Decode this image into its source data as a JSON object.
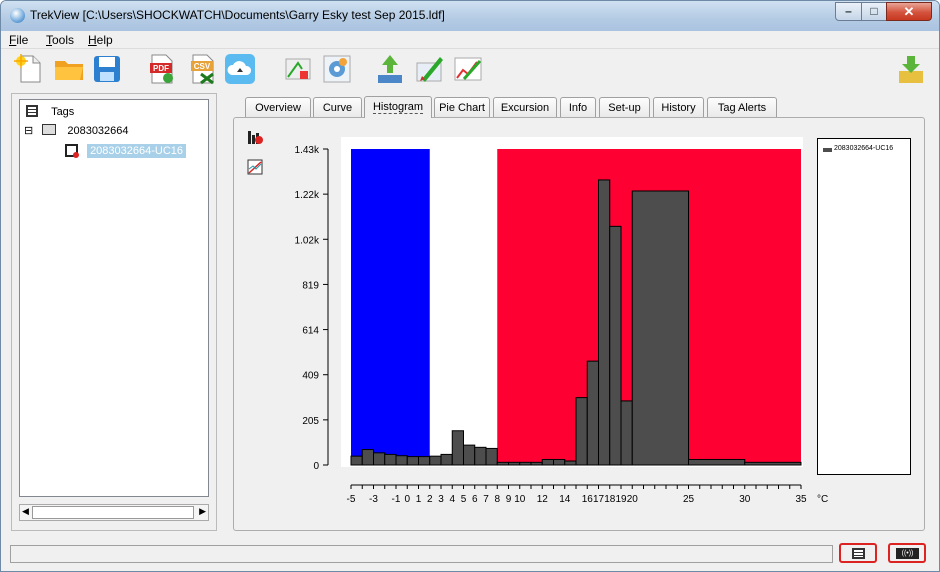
{
  "window": {
    "title": "TrekView [C:\\Users\\SHOCKWATCH\\Documents\\Garry Esky test Sep 2015.ldf]"
  },
  "menu": [
    {
      "label": "File",
      "u": "F",
      "rest": "ile"
    },
    {
      "label": "Tools",
      "u": "T",
      "rest": "ools"
    },
    {
      "label": "Help",
      "u": "H",
      "rest": "elp"
    }
  ],
  "toolbar": {
    "icons": [
      "new-file-icon",
      "open-folder-icon",
      "save-icon",
      "export-pdf-icon",
      "export-csv-icon",
      "cloud-icon",
      "program-tag-icon",
      "settings-icon",
      "download-icon",
      "edit-icon",
      "chart-edit-icon",
      "import-icon"
    ],
    "pdf_text": "PDF",
    "csv_text": "CSV"
  },
  "tree": {
    "root": "Tags",
    "expander": "⊟",
    "group": "2083032664",
    "item": "2083032664-UC16"
  },
  "tabs": [
    "Overview",
    "Curve",
    "Histogram",
    "Pie Chart",
    "Excursion",
    "Info",
    "Set-up",
    "History",
    "Tag Alerts"
  ],
  "active_tab": "Histogram",
  "colors": {
    "low_zone": "#0000ff",
    "high_zone": "#ff0033",
    "bar": "#4d4d4d",
    "selection": "#a8d0e8"
  },
  "chart_data": {
    "type": "bar",
    "xlabel": "",
    "ylabel": "",
    "x_unit": "°C",
    "ylim": [
      0,
      1430
    ],
    "xlim": [
      -5,
      35
    ],
    "y_ticks": [
      "0",
      "205",
      "409",
      "614",
      "819",
      "1.02k",
      "1.22k",
      "1.43k"
    ],
    "x_ticks": [
      "-5",
      "-3",
      "-1",
      "0",
      "1",
      "2",
      "3",
      "4",
      "5",
      "6",
      "7",
      "8",
      "9",
      "10",
      "12",
      "14",
      "16",
      "17",
      "18",
      "19",
      "20",
      "25",
      "30",
      "35"
    ],
    "zones": [
      {
        "from": -5,
        "to": 2,
        "color": "#0000ff"
      },
      {
        "from": 8,
        "to": 35,
        "color": "#ff0033"
      }
    ],
    "legend": [
      "2083032664-UC16"
    ],
    "series": [
      {
        "name": "2083032664-UC16",
        "bins": [
          {
            "from": -5,
            "to": -4,
            "value": 40
          },
          {
            "from": -4,
            "to": -3,
            "value": 70
          },
          {
            "from": -3,
            "to": -2,
            "value": 55
          },
          {
            "from": -2,
            "to": -1,
            "value": 48
          },
          {
            "from": -1,
            "to": 0,
            "value": 42
          },
          {
            "from": 0,
            "to": 1,
            "value": 38
          },
          {
            "from": 1,
            "to": 2,
            "value": 38
          },
          {
            "from": 2,
            "to": 3,
            "value": 40
          },
          {
            "from": 3,
            "to": 4,
            "value": 48
          },
          {
            "from": 4,
            "to": 5,
            "value": 155
          },
          {
            "from": 5,
            "to": 6,
            "value": 90
          },
          {
            "from": 6,
            "to": 7,
            "value": 80
          },
          {
            "from": 7,
            "to": 8,
            "value": 75
          },
          {
            "from": 8,
            "to": 9,
            "value": 12
          },
          {
            "from": 9,
            "to": 10,
            "value": 12
          },
          {
            "from": 10,
            "to": 11,
            "value": 12
          },
          {
            "from": 11,
            "to": 12,
            "value": 12
          },
          {
            "from": 12,
            "to": 13,
            "value": 25
          },
          {
            "from": 13,
            "to": 14,
            "value": 25
          },
          {
            "from": 14,
            "to": 15,
            "value": 18
          },
          {
            "from": 15,
            "to": 16,
            "value": 305
          },
          {
            "from": 16,
            "to": 17,
            "value": 470
          },
          {
            "from": 17,
            "to": 18,
            "value": 1290
          },
          {
            "from": 18,
            "to": 19,
            "value": 1080
          },
          {
            "from": 19,
            "to": 20,
            "value": 290
          },
          {
            "from": 20,
            "to": 25,
            "value": 1240
          },
          {
            "from": 25,
            "to": 30,
            "value": 25
          },
          {
            "from": 30,
            "to": 35,
            "value": 12
          }
        ]
      }
    ]
  },
  "status": {
    "text": ""
  }
}
